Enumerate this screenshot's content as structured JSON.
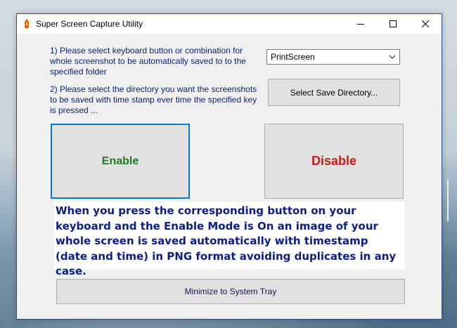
{
  "window": {
    "title": "Super Screen Capture Utility"
  },
  "instructions": {
    "step1": "1) Please select keyboard button or combination for whole screenshot to be automatically saved to to the specified folder",
    "step2": "2) Please select the directory you want the screenshots to be saved with time stamp ever time the specified key is pressed ..."
  },
  "key_select": {
    "selected": "PrintScreen"
  },
  "buttons": {
    "select_dir": "Select Save Directory...",
    "enable": "Enable",
    "disable": "Disable",
    "minimize_tray": "Minimize to System Tray"
  },
  "info": {
    "text": "When you press the corresponding button on your keyboard and the Enable Mode is On an image of your whole screen is saved automatically with timestamp (date and time) in PNG format avoiding duplicates in any case."
  },
  "colors": {
    "enable_text": "#1e7a1e",
    "disable_text": "#cc1a1a",
    "instruction_text": "#0a2370",
    "info_text": "#0a1d8a",
    "focus_border": "#0078d7"
  },
  "icons": {
    "app": "app-icon",
    "minimize": "minimize-icon",
    "maximize": "maximize-icon",
    "close": "close-icon",
    "dropdown": "chevron-down-icon"
  }
}
